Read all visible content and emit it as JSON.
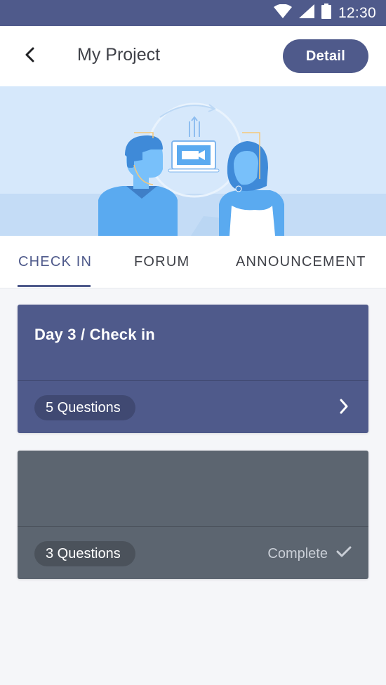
{
  "status_bar": {
    "time": "12:30",
    "icons": [
      "wifi-icon",
      "signal-icon",
      "battery-icon"
    ]
  },
  "app_bar": {
    "title": "My Project",
    "detail_label": "Detail",
    "back_icon": "chevron-left-icon"
  },
  "tabs": [
    {
      "label": "CHECK IN",
      "active": true
    },
    {
      "label": "FORUM",
      "active": false
    },
    {
      "label": "ANNOUNCEMENT",
      "active": false
    }
  ],
  "cards": [
    {
      "title": "Day 3 / Check in",
      "questions": "5 Questions",
      "action_icon": "chevron-right-icon",
      "color": "#4f5a8b"
    },
    {
      "title": "",
      "questions": "3 Questions",
      "status": "Complete",
      "status_icon": "checkmark-icon",
      "color": "#5c6570"
    }
  ],
  "colors": {
    "primary": "#4f5a8b",
    "hero_bg": "#d6e8fb",
    "figure": "#5aaaf0"
  }
}
